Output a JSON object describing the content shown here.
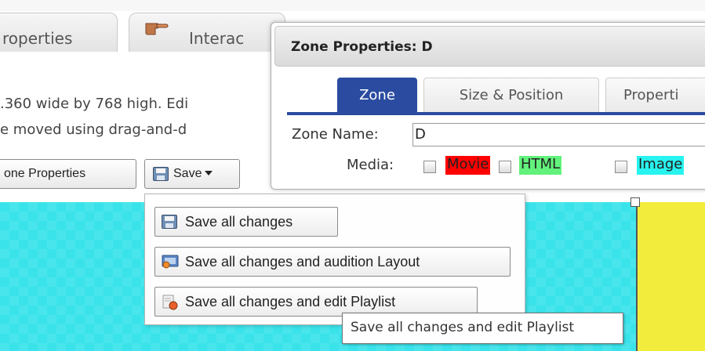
{
  "tabs": [
    {
      "label": "roperties"
    },
    {
      "label": "Interac"
    }
  ],
  "background_text": {
    "line1": ".360 wide by 768 high. Edi",
    "line2": "e moved using drag-and-d"
  },
  "toolbar": {
    "zone_properties_label": "one Properties",
    "save_label": "Save"
  },
  "dialog": {
    "title": "Zone Properties: D",
    "tabs": [
      {
        "label": "Zone"
      },
      {
        "label": "Size & Position"
      },
      {
        "label": "Properti"
      }
    ],
    "zone_name_label": "Zone Name:",
    "zone_name_value": "D",
    "media_label": "Media:",
    "media": [
      {
        "label": "Movie",
        "checked": false,
        "color": "#ff0000"
      },
      {
        "label": "HTML",
        "checked": false,
        "color": "#62f27c"
      },
      {
        "label": "Image",
        "checked": false,
        "color": "#27f3ef"
      }
    ]
  },
  "save_menu": {
    "items": [
      {
        "label": "Save all changes",
        "icon": "floppy-disk-icon"
      },
      {
        "label": "Save all changes and audition Layout",
        "icon": "audition-icon"
      },
      {
        "label": "Save all changes and edit Playlist",
        "icon": "playlist-icon"
      }
    ]
  },
  "tooltip": {
    "text": "Save all changes and edit Playlist"
  },
  "colors": {
    "canvas_zone": "#3ae3ea",
    "yellow_zone": "#f2ec3c",
    "active_tab": "#2a4ba0"
  }
}
